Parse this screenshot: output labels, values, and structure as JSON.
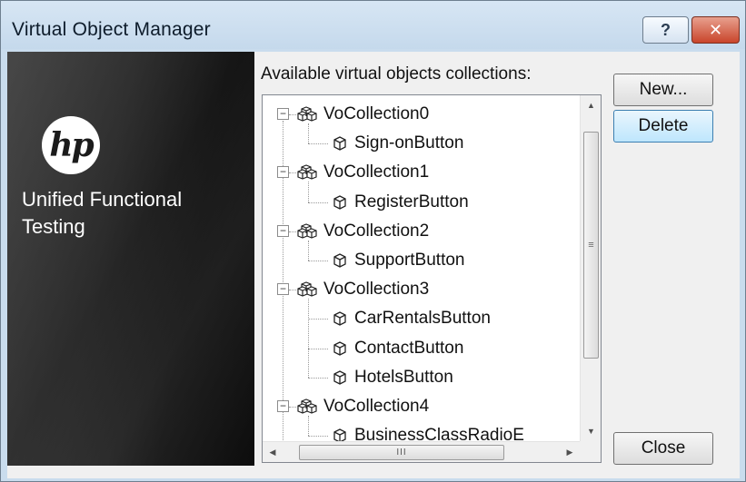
{
  "window": {
    "title": "Virtual Object Manager"
  },
  "titlebar": {
    "help_label": "?",
    "close_label": "✕"
  },
  "brand": {
    "logo_text": "hp",
    "product_line1": "Unified Functional",
    "product_line2": "Testing"
  },
  "tree": {
    "label": "Available virtual objects collections:",
    "collections": [
      {
        "name": "VoCollection0",
        "children": [
          "Sign-onButton"
        ]
      },
      {
        "name": "VoCollection1",
        "children": [
          "RegisterButton"
        ]
      },
      {
        "name": "VoCollection2",
        "children": [
          "SupportButton"
        ]
      },
      {
        "name": "VoCollection3",
        "children": [
          "CarRentalsButton",
          "ContactButton",
          "HotelsButton"
        ]
      },
      {
        "name": "VoCollection4",
        "children": [
          "BusinessClassRadioE"
        ]
      }
    ],
    "expander_symbol": "−",
    "hscroll_grip": "III",
    "vscroll_grip": "≡",
    "icons": {
      "collection": "cube-group-icon",
      "object": "cube-icon"
    }
  },
  "buttons": {
    "new_label": "New...",
    "delete_label": "Delete",
    "close_label": "Close"
  }
}
